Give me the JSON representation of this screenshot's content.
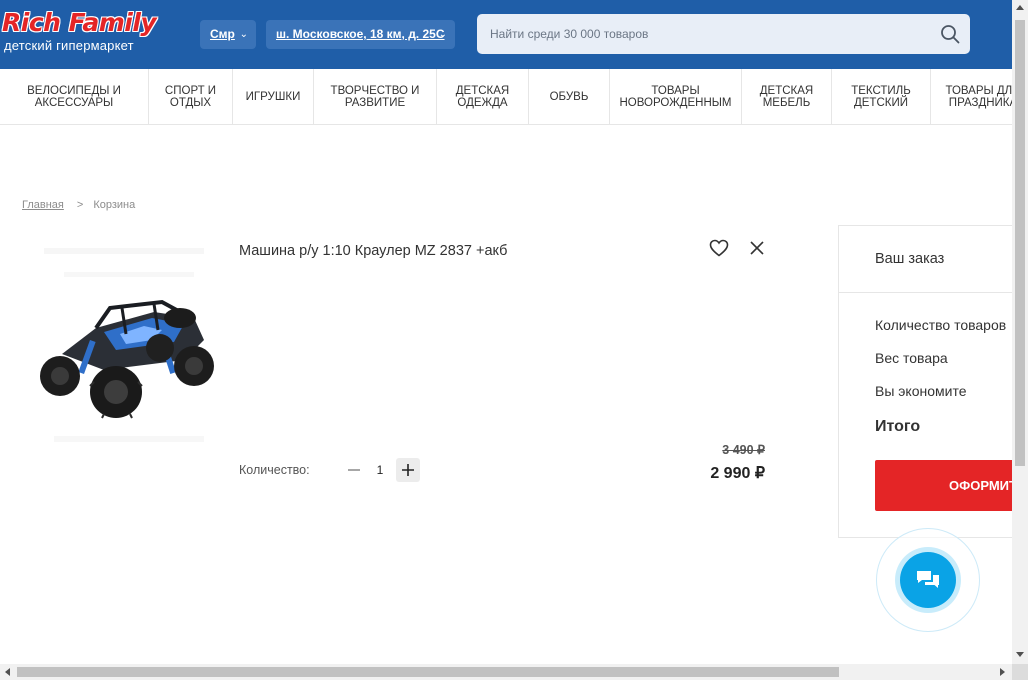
{
  "header": {
    "logo_title": "Rich Family",
    "logo_subtitle": "детский гипермаркет",
    "city": "Смр",
    "address": "ш. Московское, 18 км, д. 25С",
    "search_placeholder": "Найти среди 30 000 товаров",
    "brand_color": "#1f5ea8",
    "accent_color": "#e42526"
  },
  "categories": [
    {
      "label": "ВЕЛОСИПЕДЫ И\nАКСЕССУАРЫ"
    },
    {
      "label": "СПОРТ И\nОТДЫХ"
    },
    {
      "label": "ИГРУШКИ"
    },
    {
      "label": "ТВОРЧЕСТВО И\nРАЗВИТИЕ"
    },
    {
      "label": "ДЕТСКАЯ\nОДЕЖДА"
    },
    {
      "label": "ОБУВЬ"
    },
    {
      "label": "ТОВАРЫ\nНОВОРОЖДЕННЫМ"
    },
    {
      "label": "ДЕТСКАЯ\nМЕБЕЛЬ"
    },
    {
      "label": "ТЕКСТИЛЬ\nДЕТСКИЙ"
    },
    {
      "label": "ТОВАРЫ ДЛЯ\nПРАЗДНИКА"
    }
  ],
  "breadcrumb": {
    "home": "Главная",
    "separator": ">",
    "current": "Корзина"
  },
  "cart_item": {
    "title": "Машина р/у 1:10 Краулер MZ 2837 +акб",
    "quantity_label": "Количество:",
    "quantity": "1",
    "minus": "−",
    "plus": "+",
    "old_price": "3 490 ₽",
    "price": "2 990 ₽"
  },
  "order": {
    "heading": "Ваш заказ",
    "count_label": "Количество товаров",
    "weight_label": "Вес товара",
    "savings_label": "Вы экономите",
    "total_label": "Итого",
    "checkout_label": "ОФОРМИТЬ"
  },
  "icons": {
    "chevron": "chevron-down-icon",
    "search": "search-icon",
    "favorite": "heart-icon",
    "remove": "close-icon",
    "chat": "chat-icon"
  }
}
